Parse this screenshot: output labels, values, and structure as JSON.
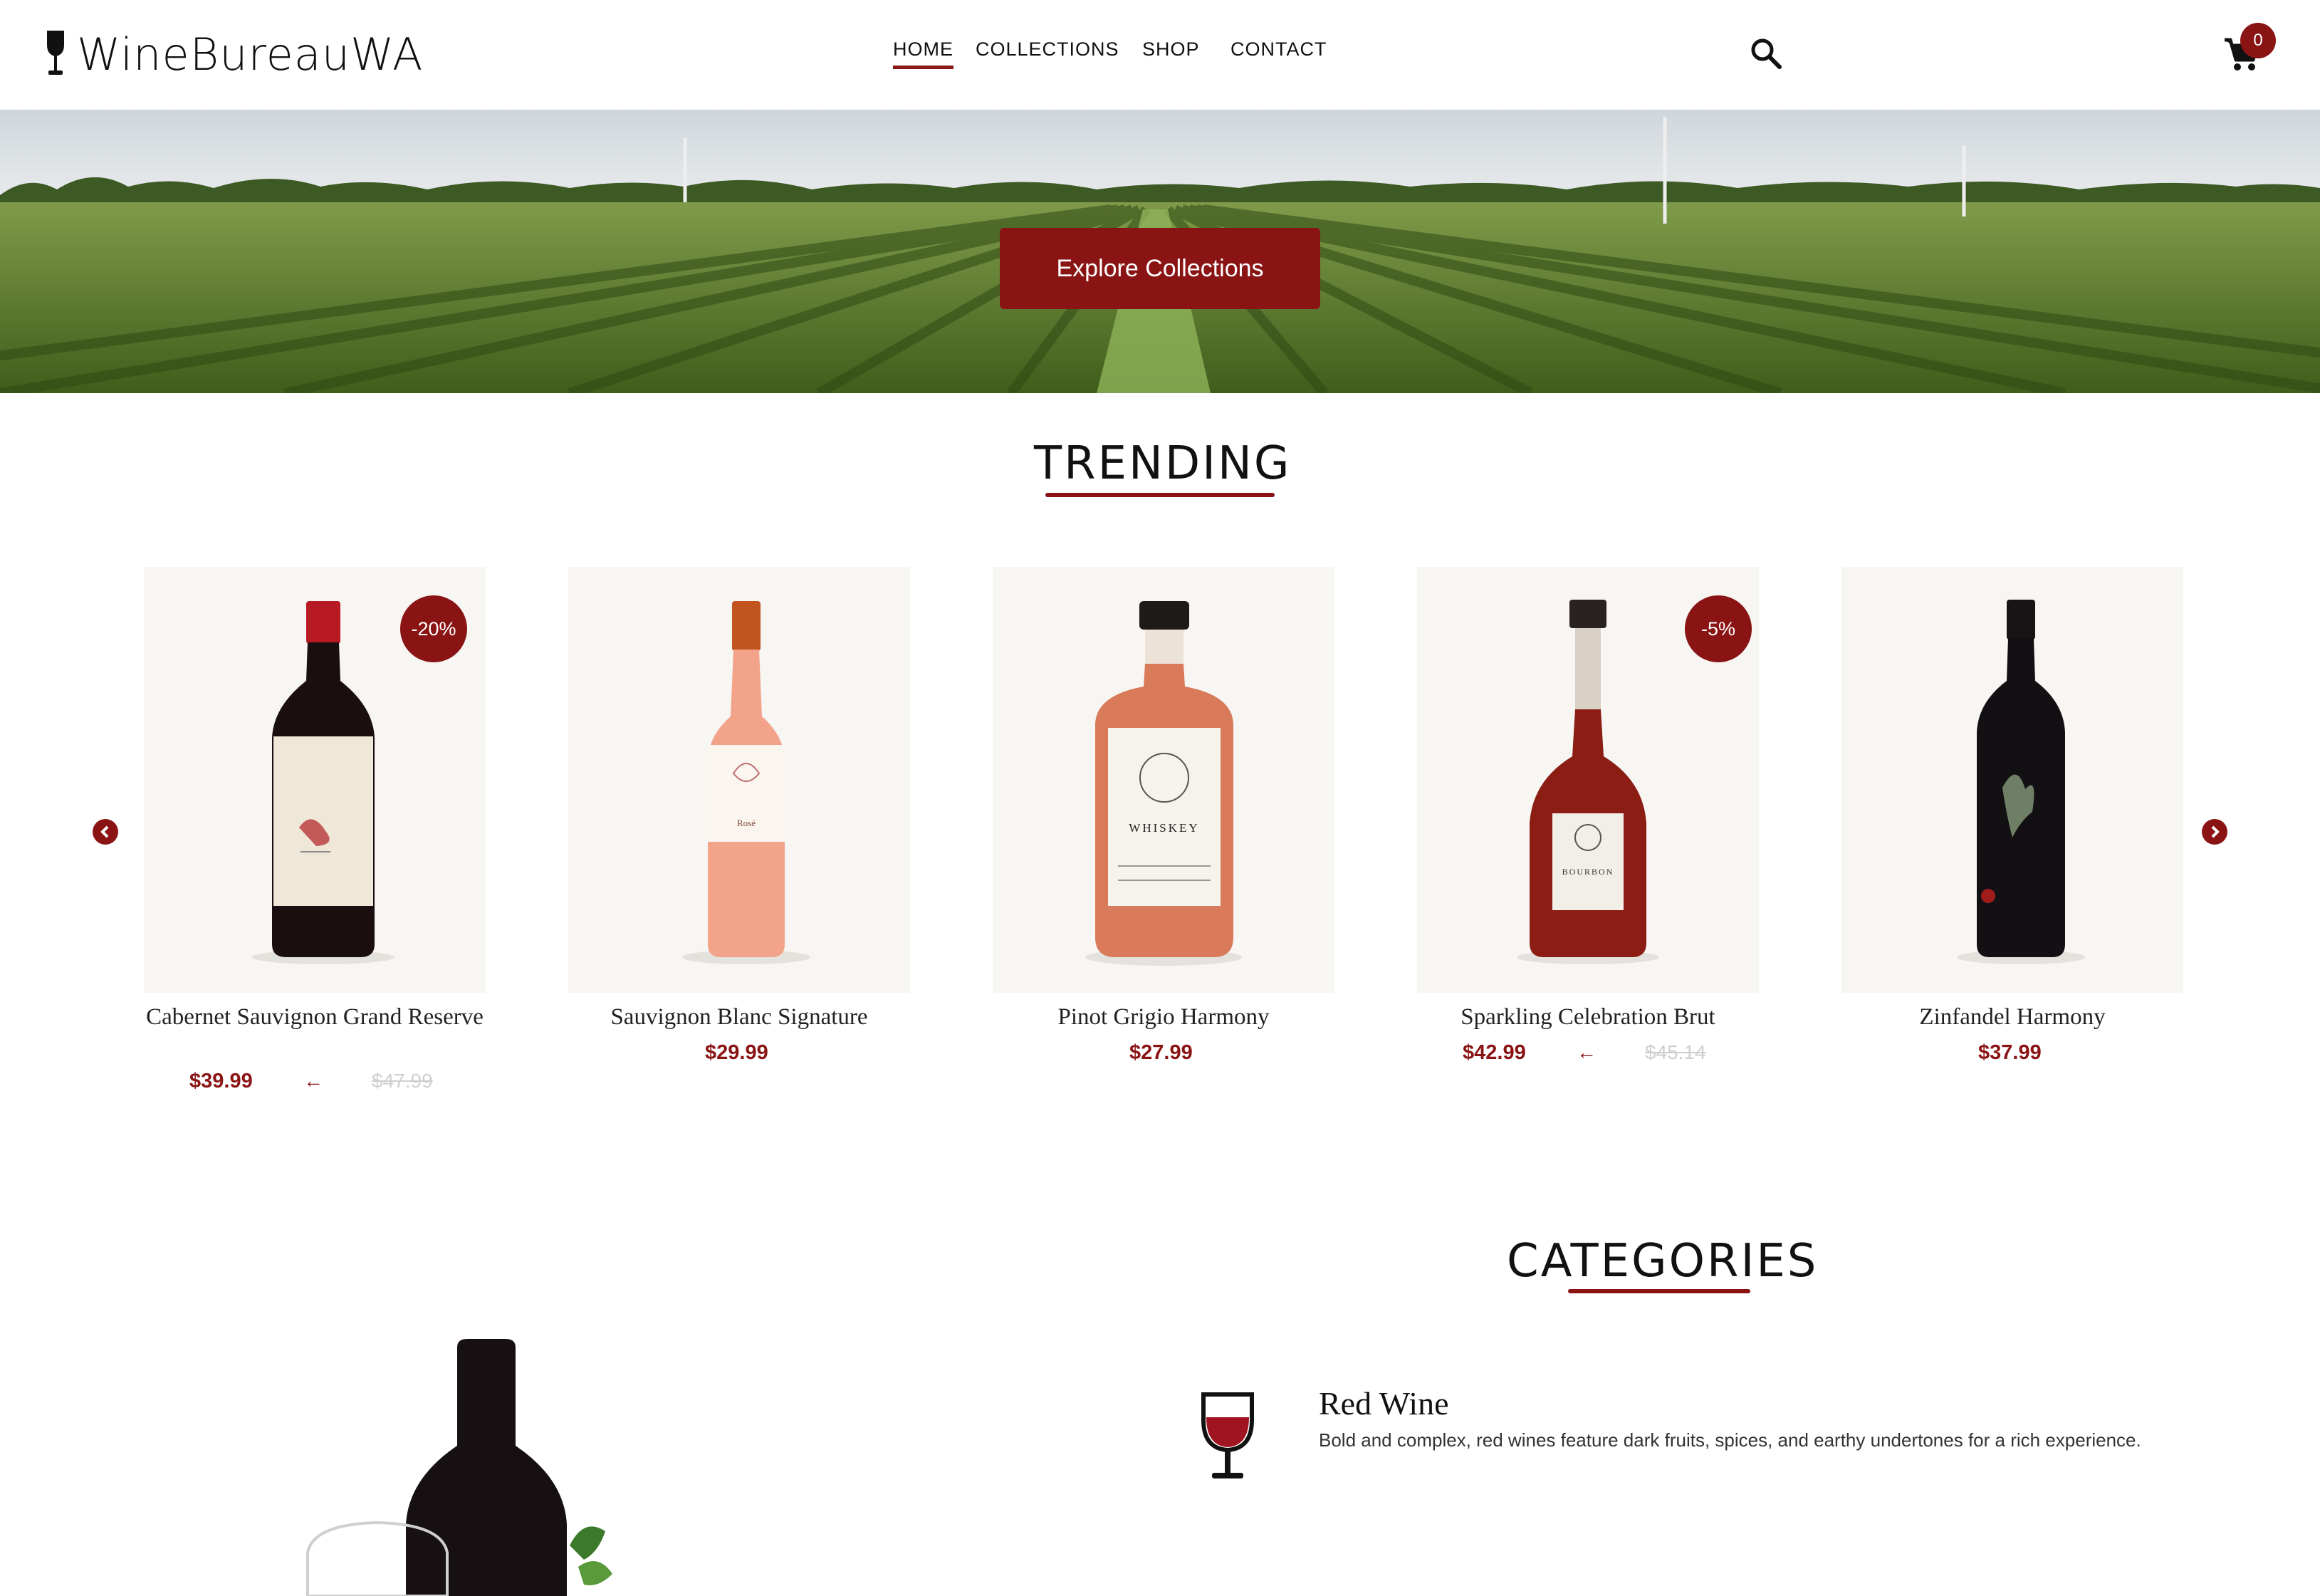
{
  "brand": {
    "name": "WineBureauWA"
  },
  "nav": {
    "items": [
      {
        "label": "HOME",
        "active": true
      },
      {
        "label": "COLLECTIONS"
      },
      {
        "label": "SHOP"
      },
      {
        "label": "CONTACT"
      }
    ]
  },
  "cart": {
    "count": "0"
  },
  "hero": {
    "cta_label": "Explore Collections"
  },
  "trending": {
    "title": "TRENDING",
    "products": [
      {
        "name": "Cabernet Sauvignon Grand Reserve",
        "price": "$39.99",
        "old_price": "$47.99",
        "discount": "-20%",
        "bottle": "red"
      },
      {
        "name": "Sauvignon Blanc Signature",
        "price": "$29.99",
        "bottle": "rose",
        "label_text": "Rosé"
      },
      {
        "name": "Pinot Grigio Harmony",
        "price": "$27.99",
        "bottle": "whiskey",
        "label_text": "WHISKEY"
      },
      {
        "name": "Sparkling Celebration Brut",
        "price": "$42.99",
        "old_price": "$45.14",
        "discount": "-5%",
        "bottle": "bourbon",
        "label_text": "BOURBON"
      },
      {
        "name": "Zinfandel Harmony",
        "price": "$37.99",
        "bottle": "dark"
      }
    ]
  },
  "categories": {
    "title": "CATEGORIES",
    "items": [
      {
        "name": "Red Wine",
        "description": "Bold and complex, red wines feature dark fruits, spices, and earthy undertones for a rich experience."
      }
    ]
  },
  "colors": {
    "accent": "#8a1414",
    "card_bg": "#f7f6f3",
    "old_price": "#cfcfcf"
  }
}
